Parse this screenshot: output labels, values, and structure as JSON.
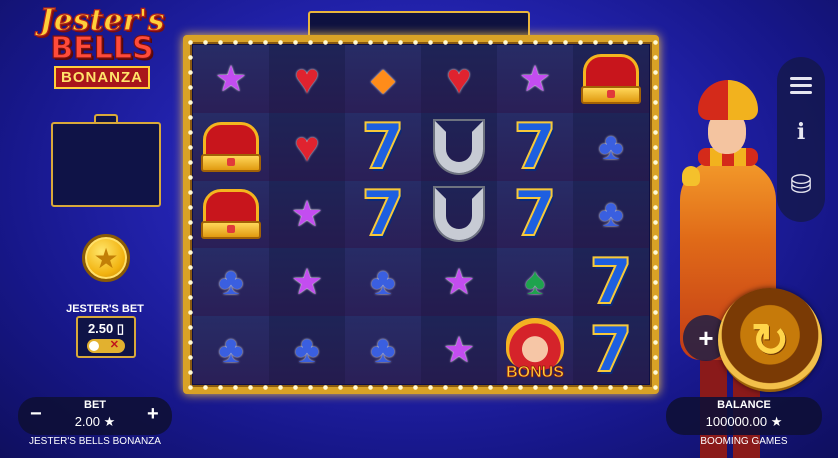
{
  "logo": {
    "line1": "Jester's",
    "line2": "BELLS",
    "line3": "BONANZA"
  },
  "jesters_bet": {
    "label": "JESTER'S BET",
    "value": "2.50 ▯",
    "toggle_off": "✕"
  },
  "coin_icon": "star-coin-icon",
  "reels": [
    [
      "star",
      "crown",
      "crown",
      "club",
      "club"
    ],
    [
      "heart",
      "heart",
      "star",
      "star",
      "club"
    ],
    [
      "diamond",
      "seven",
      "seven",
      "club",
      "club"
    ],
    [
      "heart",
      "horseshoe",
      "horseshoe",
      "star",
      "star"
    ],
    [
      "star",
      "seven",
      "seven",
      "spade",
      "bonus"
    ],
    [
      "crown",
      "club",
      "club",
      "seven",
      "seven"
    ]
  ],
  "symbol_glyphs": {
    "star": "★",
    "heart": "♥",
    "diamond": "◆",
    "club": "♣",
    "spade": "♠",
    "seven": "7"
  },
  "bonus_label": "BONUS",
  "bet": {
    "label": "BET",
    "value": "2.00 ★",
    "minus": "−",
    "plus": "+"
  },
  "game_name": "JESTER'S BELLS BONANZA",
  "balance": {
    "label": "BALANCE",
    "value": "100000.00 ★"
  },
  "brand": "BOOMING GAMES",
  "right_menu": {
    "info": "i"
  },
  "spin_glyph": "↻",
  "autoplay_glyph": "+",
  "colors": {
    "frame_gold": "#d9a226",
    "background": "#2626b8",
    "accent_red": "#c8151c"
  }
}
